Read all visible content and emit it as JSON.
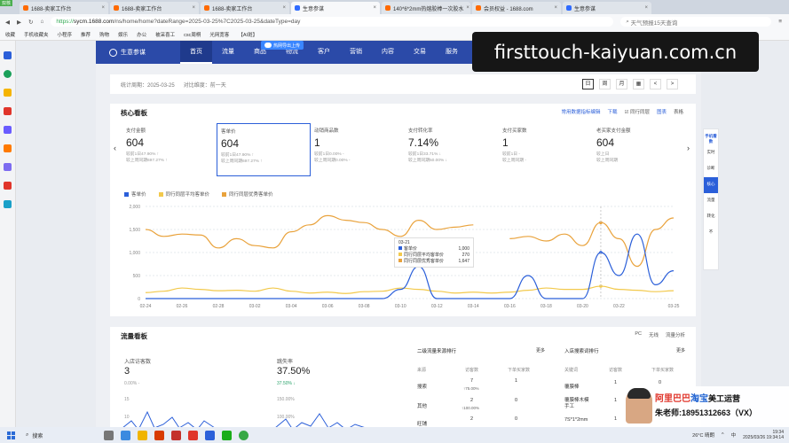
{
  "browser": {
    "version_badge": "双核",
    "tabs": [
      {
        "title": "1688-卖家工作台"
      },
      {
        "title": "1688-卖家工作台"
      },
      {
        "title": "1688-卖家工作台"
      },
      {
        "title": "生意参谋",
        "active": true
      },
      {
        "title": "140*6*2mm热熔胶棒一次胶水"
      },
      {
        "title": "会员权益 - 1688.com"
      },
      {
        "title": "生意参谋"
      }
    ],
    "url_scheme": "https://",
    "url_host": "sycm.1688.com",
    "url_path": "/ns/home/home?dateRange=2025-03-25%7C2025-03-25&dateType=day",
    "search_placeholder": "天气预报15天查询",
    "bookmarks": [
      "收藏",
      "手机收藏夹",
      "小程序",
      "推荐",
      "购物",
      "娱乐",
      "办公",
      "被采喜工",
      "csc周桐",
      "光网宽客",
      "【AI斑】"
    ]
  },
  "upload_label": "热网导出上传",
  "nav": {
    "logo": "生意参谋",
    "items": [
      "首页",
      "流量",
      "商品",
      "物流",
      "客户",
      "营销",
      "内容",
      "交易",
      "服务"
    ]
  },
  "watermark": "firsttouch-kaiyuan.com.cn",
  "datebar": {
    "period_label": "统计周期：",
    "period_value": "2025-03-25",
    "compare_label": "对比维度：",
    "compare_value": "前一天",
    "controls": [
      "日",
      "周",
      "月",
      "",
      "<",
      ">"
    ]
  },
  "core": {
    "title": "核心看板",
    "tools": [
      "常用数据指标编辑",
      "下载",
      "同行同层",
      "图表",
      "表格"
    ],
    "metrics": [
      {
        "label": "支付金额",
        "value": "604",
        "sub1": "较前1日47.90% ↑",
        "sub2": "较上周同期697.27% ↑"
      },
      {
        "label": "客单价",
        "value": "604",
        "sub1": "较前1日47.90% ↑",
        "sub2": "较上周同期697.27% ↑"
      },
      {
        "label": "动销商品数",
        "value": "1",
        "sub1": "较前1日0.00% -",
        "sub2": "较上周同期0.00% -"
      },
      {
        "label": "支付转化率",
        "value": "7.14%",
        "sub1": "较前1日33.71% ↓",
        "sub2": "较上周同期50.00% ↓"
      },
      {
        "label": "支付买家数",
        "value": "1",
        "sub1": "较前1日 -",
        "sub2": "较上周同期 -"
      },
      {
        "label": "老买家支付金额",
        "value": "604",
        "sub1": "较上日",
        "sub2": "较上周同期"
      }
    ],
    "legend": [
      {
        "name": "客单价",
        "color": "#2b5fd9"
      },
      {
        "name": "同行同层平均客单价",
        "color": "#f2c94c"
      },
      {
        "name": "同行同层优秀客单价",
        "color": "#e9a23b"
      }
    ],
    "tooltip": {
      "date": "03-21",
      "rows": [
        {
          "name": "客单价",
          "value": "1,000"
        },
        {
          "name": "同行同层平均客单价",
          "value": "270"
        },
        {
          "name": "同行同层优秀客单价",
          "value": "1,647"
        }
      ]
    }
  },
  "chart_data": {
    "type": "line",
    "x": [
      "02-24",
      "02-25",
      "02-26",
      "02-27",
      "02-28",
      "03-01",
      "03-02",
      "03-03",
      "03-04",
      "03-05",
      "03-06",
      "03-07",
      "03-08",
      "03-09",
      "03-10",
      "03-11",
      "03-12",
      "03-13",
      "03-14",
      "03-15",
      "03-16",
      "03-17",
      "03-18",
      "03-19",
      "03-20",
      "03-21",
      "03-22",
      "03-23",
      "03-24",
      "03-25"
    ],
    "x_tick_labels": [
      "02-24",
      "02-26",
      "02-28",
      "03-02",
      "03-04",
      "03-06",
      "03-08",
      "03-10",
      "03-12",
      "03-14",
      "03-16",
      "03-18",
      "03-20",
      "03-22",
      "03-25"
    ],
    "ylim": [
      0,
      2000
    ],
    "yticks": [
      "0",
      "500",
      "1,000",
      "1,500",
      "2,000"
    ],
    "series": [
      {
        "name": "客单价",
        "color": "#2b5fd9",
        "values": [
          0,
          0,
          0,
          0,
          0,
          0,
          0,
          0,
          0,
          0,
          0,
          0,
          0,
          0,
          200,
          700,
          0,
          0,
          0,
          0,
          0,
          500,
          0,
          0,
          0,
          1000,
          500,
          1400,
          300,
          604
        ]
      },
      {
        "name": "同行同层平均客单价",
        "color": "#f2c94c",
        "values": [
          130,
          160,
          230,
          200,
          170,
          180,
          160,
          230,
          160,
          120,
          140,
          110,
          150,
          160,
          230,
          200,
          160,
          120,
          140,
          120,
          140,
          180,
          230,
          200,
          200,
          270,
          200,
          180,
          150,
          170
        ]
      },
      {
        "name": "同行同层优秀客单价",
        "color": "#e9a23b",
        "values": [
          1500,
          1350,
          1400,
          1380,
          1100,
          1300,
          1150,
          1100,
          1450,
          1600,
          1800,
          1700,
          1650,
          1500,
          1350,
          1700,
          1500,
          1550,
          1600,
          null,
          1300,
          1350,
          1250,
          1400,
          1150,
          1650,
          1300,
          700,
          1500,
          1750
        ]
      }
    ]
  },
  "flow": {
    "title": "流量看板",
    "tools": [
      "PC",
      "无线",
      "流量分析"
    ],
    "m1_label": "入店访客数",
    "m1_value": "3",
    "m1_sub": "0.00% -",
    "m2_label": "跳失率",
    "m2_value": "37.50%",
    "m2_sub": "37.50% ↓",
    "axis1": [
      "15",
      "10"
    ],
    "axis2": [
      "150.00%",
      "100.00%"
    ],
    "source_title": "二级流量来源排行",
    "source_more": "更多",
    "source_cols": [
      "来源",
      "访客数",
      "下单买家数"
    ],
    "source_rows": [
      {
        "name": "搜索",
        "v": "7",
        "c": "↑75.00%",
        "b": "1"
      },
      {
        "name": "其他",
        "v": "2",
        "c": "↑100.00%",
        "b": "0"
      },
      {
        "name": "旺铺",
        "v": "2",
        "c": "",
        "b": "0"
      }
    ],
    "kw_title": "入店搜索词排行",
    "kw_more": "更多",
    "kw_cols": [
      "关键词",
      "访客数",
      "下单买家数"
    ],
    "kw_rows": [
      {
        "name": "覆膜棒",
        "v": "1",
        "b": "0"
      },
      {
        "name": "覆膜棒木模手工",
        "v": "1",
        "b": "0"
      },
      {
        "name": "7S*1*2mm",
        "v": "1",
        "b": "0"
      }
    ]
  },
  "right_nav": [
    "手机看数",
    "实时",
    "诊断",
    "核心",
    "流量",
    "转化",
    "不"
  ],
  "promo": {
    "line1_a": "阿里巴巴",
    "line1_b": "淘宝",
    "line1_c": "美工运营",
    "line2": "朱老师:18951312663（VX）"
  },
  "taskbar": {
    "search": "搜索",
    "weather": "26°C 晴朗",
    "time": "19:34",
    "date": "2025/03/26 19:34:14"
  }
}
